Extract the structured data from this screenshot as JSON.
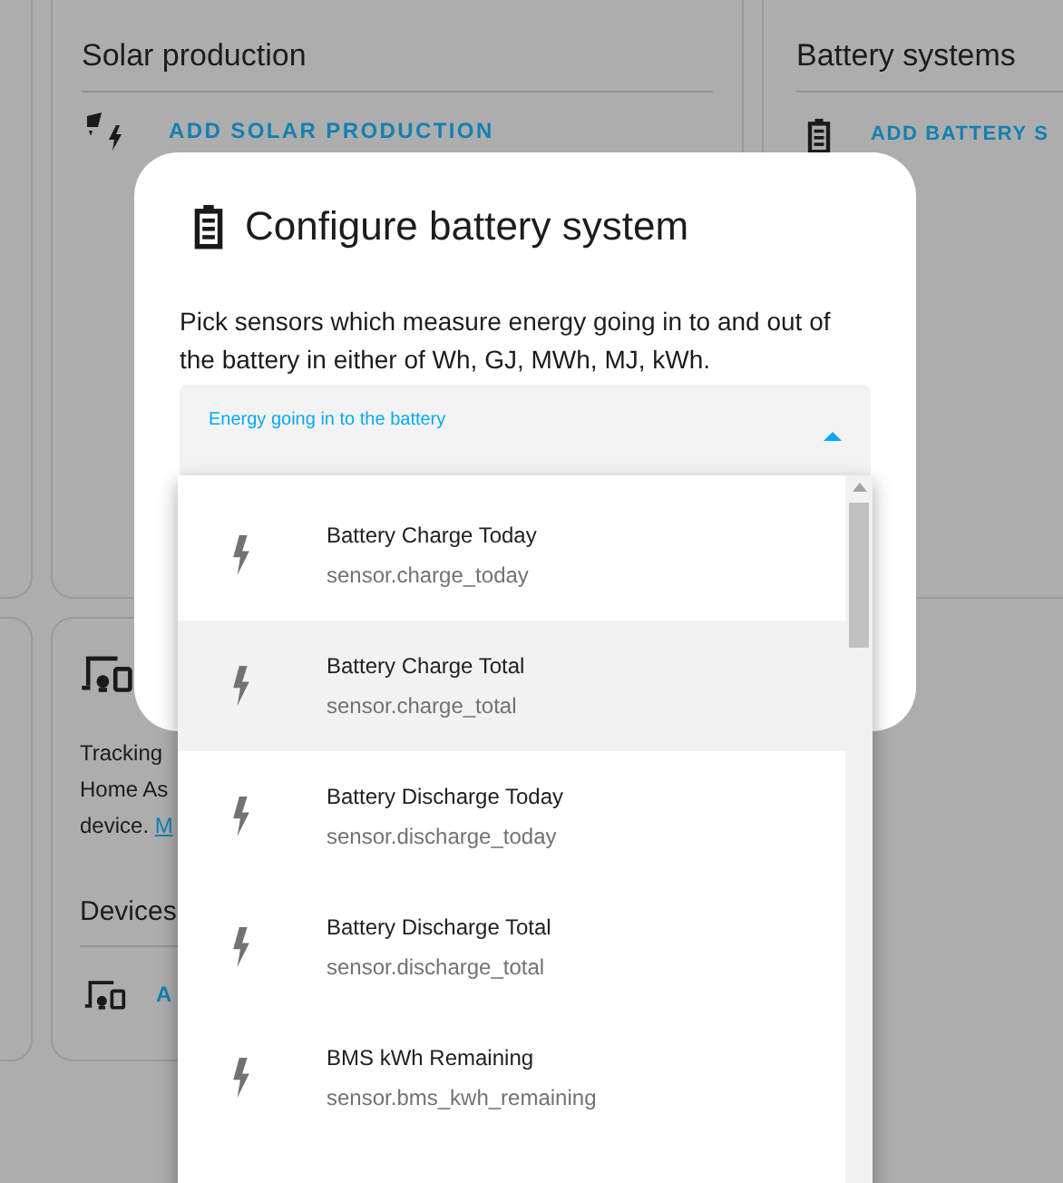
{
  "background": {
    "solar": {
      "title": "Solar production",
      "action": "ADD SOLAR PRODUCTION"
    },
    "battery": {
      "title": "Battery systems",
      "action": "ADD BATTERY S"
    },
    "devices_card": {
      "text_lines": [
        "Tracking",
        "Home As",
        "device."
      ],
      "link": "M",
      "section_title": "Devices",
      "action": "A"
    }
  },
  "dialog": {
    "title": "Configure battery system",
    "description": "Pick sensors which measure energy going in to and out of the battery in either of Wh, GJ, MWh, MJ, kWh.",
    "field": {
      "label": "Energy going in to the battery",
      "expanded": true
    },
    "options": [
      {
        "name": "Battery Charge Today",
        "entity": "sensor.charge_today",
        "selected": false
      },
      {
        "name": "Battery Charge Total",
        "entity": "sensor.charge_total",
        "selected": true
      },
      {
        "name": "Battery Discharge Today",
        "entity": "sensor.discharge_today",
        "selected": false
      },
      {
        "name": "Battery Discharge Total",
        "entity": "sensor.discharge_total",
        "selected": false
      },
      {
        "name": "BMS kWh Remaining",
        "entity": "sensor.bms_kwh_remaining",
        "selected": false
      }
    ]
  }
}
